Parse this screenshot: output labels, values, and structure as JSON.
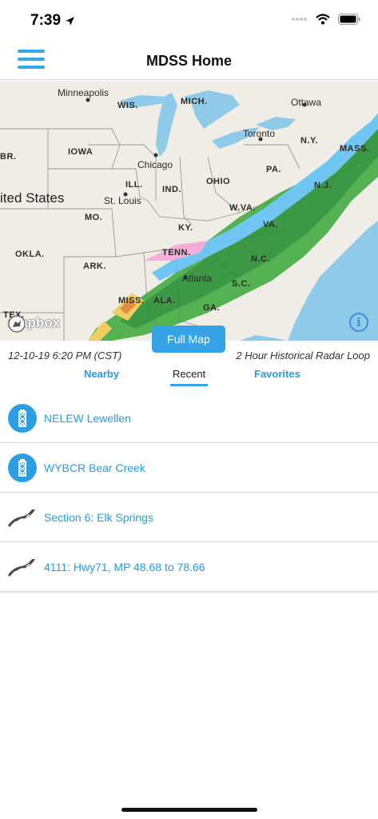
{
  "status": {
    "time": "7:39"
  },
  "nav": {
    "title": "MDSS Home"
  },
  "map": {
    "states": [
      "WIS.",
      "MICH.",
      "IOWA",
      "ILL.",
      "IND.",
      "OHIO",
      "PA.",
      "N.Y.",
      "MASS.",
      "N.J.",
      "W.VA.",
      "VA.",
      "KY.",
      "TENN.",
      "N.C.",
      "S.C.",
      "GA.",
      "ALA.",
      "MISS.",
      "ARK.",
      "MO.",
      "OKLA.",
      "TEX.",
      "BR."
    ],
    "cities": [
      "Minneapolis",
      "Chicago",
      "St. Louis",
      "Atlanta",
      "Toronto",
      "Ottawa"
    ],
    "country": "ited States",
    "attribution": "mapbox",
    "info_glyph": "i"
  },
  "full_map_label": "Full Map",
  "timestamp": "12-10-19 6:20 PM (CST)",
  "radar_label": "2 Hour Historical Radar Loop",
  "tabs": [
    {
      "label": "Nearby",
      "active": false
    },
    {
      "label": "Recent",
      "active": true
    },
    {
      "label": "Favorites",
      "active": false
    }
  ],
  "items": [
    {
      "label": "NELEW Lewellen",
      "icon": "station-icon"
    },
    {
      "label": "WYBCR Bear Creek",
      "icon": "station-icon"
    },
    {
      "label": "Section 6: Elk Springs",
      "icon": "road-icon"
    },
    {
      "label": "4111: Hwy71, MP 48.68 to 78.66",
      "icon": "road-icon"
    }
  ],
  "colors": {
    "accent": "#34a4e6",
    "link": "#2a9be0",
    "water": "#8fcbe8"
  }
}
